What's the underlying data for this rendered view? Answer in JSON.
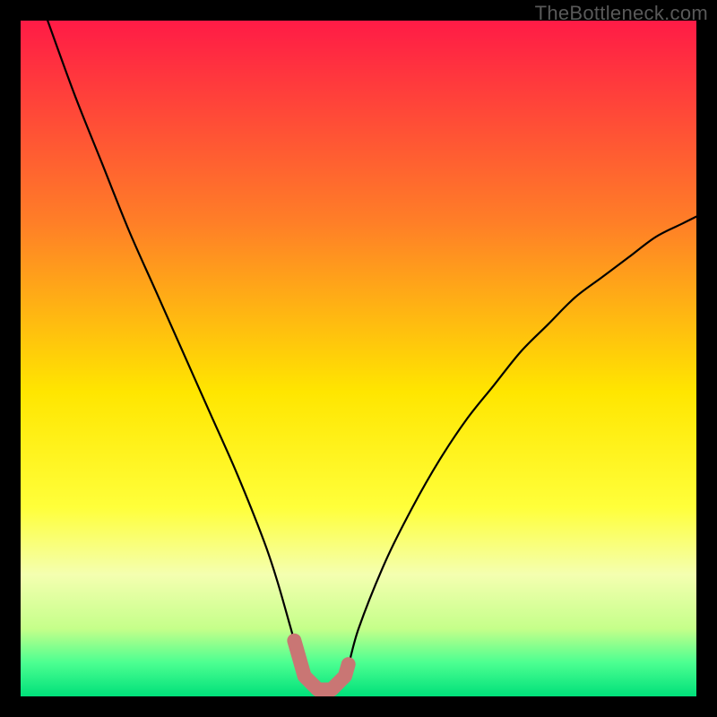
{
  "watermark": "TheBottleneck.com",
  "chart_data": {
    "type": "line",
    "title": "",
    "xlabel": "",
    "ylabel": "",
    "xlim": [
      0,
      100
    ],
    "ylim": [
      0,
      100
    ],
    "series": [
      {
        "name": "bottleneck-curve",
        "x": [
          4,
          8,
          12,
          16,
          20,
          24,
          28,
          32,
          36,
          38,
          40,
          42,
          44,
          46,
          48,
          50,
          54,
          58,
          62,
          66,
          70,
          74,
          78,
          82,
          86,
          90,
          94,
          98,
          100
        ],
        "y": [
          100,
          89,
          79,
          69,
          60,
          51,
          42,
          33,
          23,
          17,
          10,
          3,
          1,
          1,
          3,
          10,
          20,
          28,
          35,
          41,
          46,
          51,
          55,
          59,
          62,
          65,
          68,
          70,
          71
        ]
      }
    ],
    "annotations": [
      {
        "name": "optimal-range-marker",
        "x_start": 40.5,
        "x_end": 48.5,
        "color": "#c97674"
      }
    ],
    "background_gradient": {
      "stops": [
        {
          "offset": 0.0,
          "color": "#ff1b46"
        },
        {
          "offset": 0.3,
          "color": "#ff7f27"
        },
        {
          "offset": 0.55,
          "color": "#ffe600"
        },
        {
          "offset": 0.72,
          "color": "#ffff3a"
        },
        {
          "offset": 0.82,
          "color": "#f4ffb0"
        },
        {
          "offset": 0.9,
          "color": "#c5ff8a"
        },
        {
          "offset": 0.95,
          "color": "#4cff91"
        },
        {
          "offset": 1.0,
          "color": "#00e07a"
        }
      ]
    }
  }
}
